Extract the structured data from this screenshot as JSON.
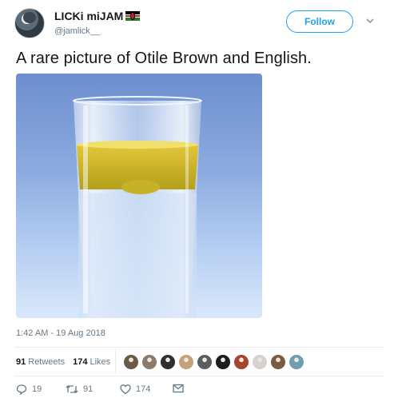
{
  "user": {
    "display_name": "LICKi miJAM",
    "handle": "@jamlick__",
    "flag_icon": "kenya-flag-icon"
  },
  "follow_label": "Follow",
  "tweet": {
    "text": "A rare picture of Otile Brown and English.",
    "timestamp": "1:42 AM - 19 Aug 2018"
  },
  "stats": {
    "retweets_count": "91",
    "retweets_label": "Retweets",
    "likes_count": "174",
    "likes_label": "Likes"
  },
  "likers": [
    "#6b5a48",
    "#8c7a6e",
    "#2f2f2f",
    "#c4a27a",
    "#5a5e63",
    "#1d1d1d",
    "#a5452e",
    "#d7d2cf",
    "#7a5b44",
    "#6f9eb0"
  ],
  "actions": {
    "reply_count": "19",
    "retweet_count": "91",
    "like_count": "174"
  },
  "colors": {
    "accent": "#1da1f2",
    "secondary_text": "#657786"
  }
}
